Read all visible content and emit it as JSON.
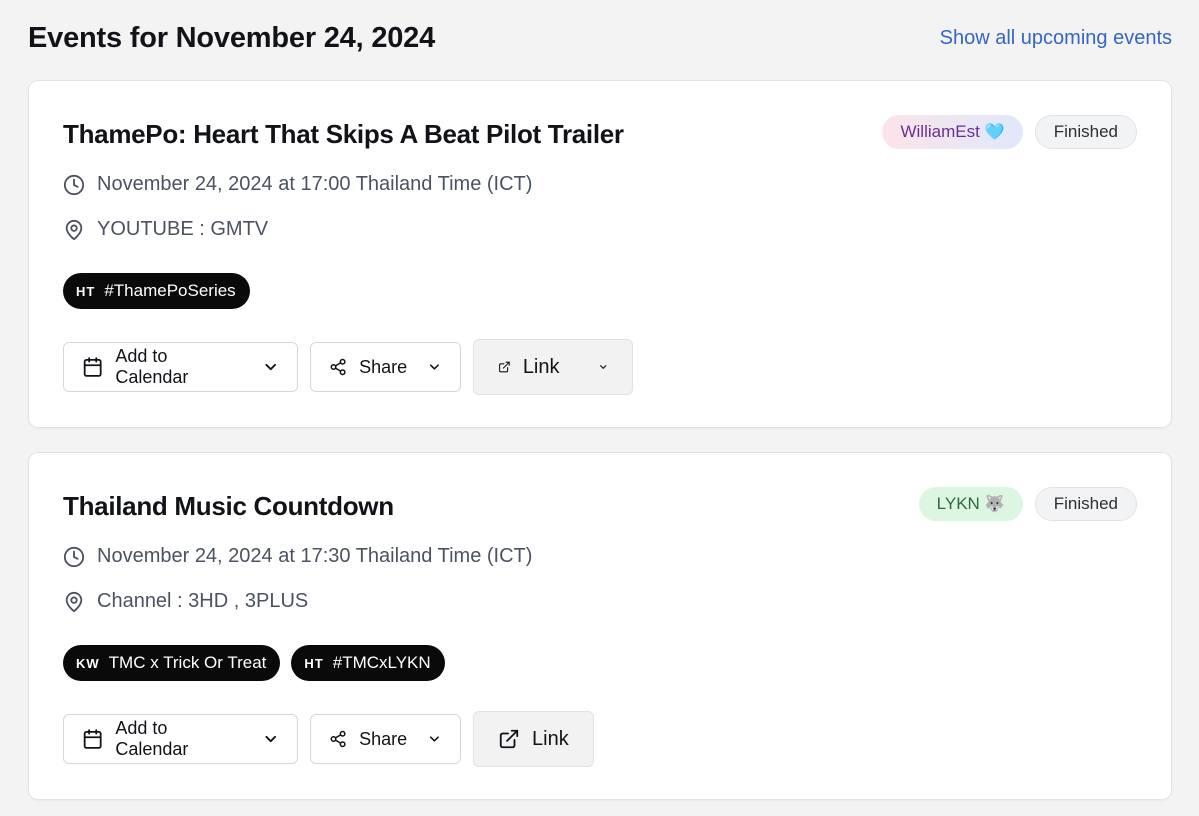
{
  "header": {
    "title": "Events for November 24, 2024",
    "show_all_label": "Show all upcoming events"
  },
  "events": [
    {
      "title": "ThamePo: Heart That Skips A Beat Pilot Trailer",
      "artist_badge": "WilliamEst",
      "artist_emoji": "🩵",
      "status": "Finished",
      "datetime": "November 24, 2024 at 17:00 Thailand Time (ICT)",
      "location": "YOUTUBE : GMTV",
      "tags": [
        {
          "type": "HT",
          "text": "#ThamePoSeries"
        }
      ],
      "actions": {
        "calendar_label": "Add to Calendar",
        "share_label": "Share",
        "link_label": "Link"
      }
    },
    {
      "title": "Thailand Music Countdown",
      "artist_badge": "LYKN",
      "artist_emoji": "🐺",
      "status": "Finished",
      "datetime": "November 24, 2024 at 17:30 Thailand Time (ICT)",
      "location": "Channel : 3HD , 3PLUS",
      "tags": [
        {
          "type": "KW",
          "text": "TMC x Trick Or Treat"
        },
        {
          "type": "HT",
          "text": "#TMCxLYKN"
        }
      ],
      "actions": {
        "calendar_label": "Add to Calendar",
        "share_label": "Share",
        "link_label": "Link"
      }
    }
  ],
  "colors": {
    "link": "#3566c4",
    "tag_bg": "#0a0a0a",
    "badge_green": "#dcf6e2",
    "badge_pink": "#fce4ea"
  },
  "icons": [
    "clock-icon",
    "map-pin-icon",
    "calendar-icon",
    "share-icon",
    "external-link-icon",
    "chevron-down-icon"
  ]
}
